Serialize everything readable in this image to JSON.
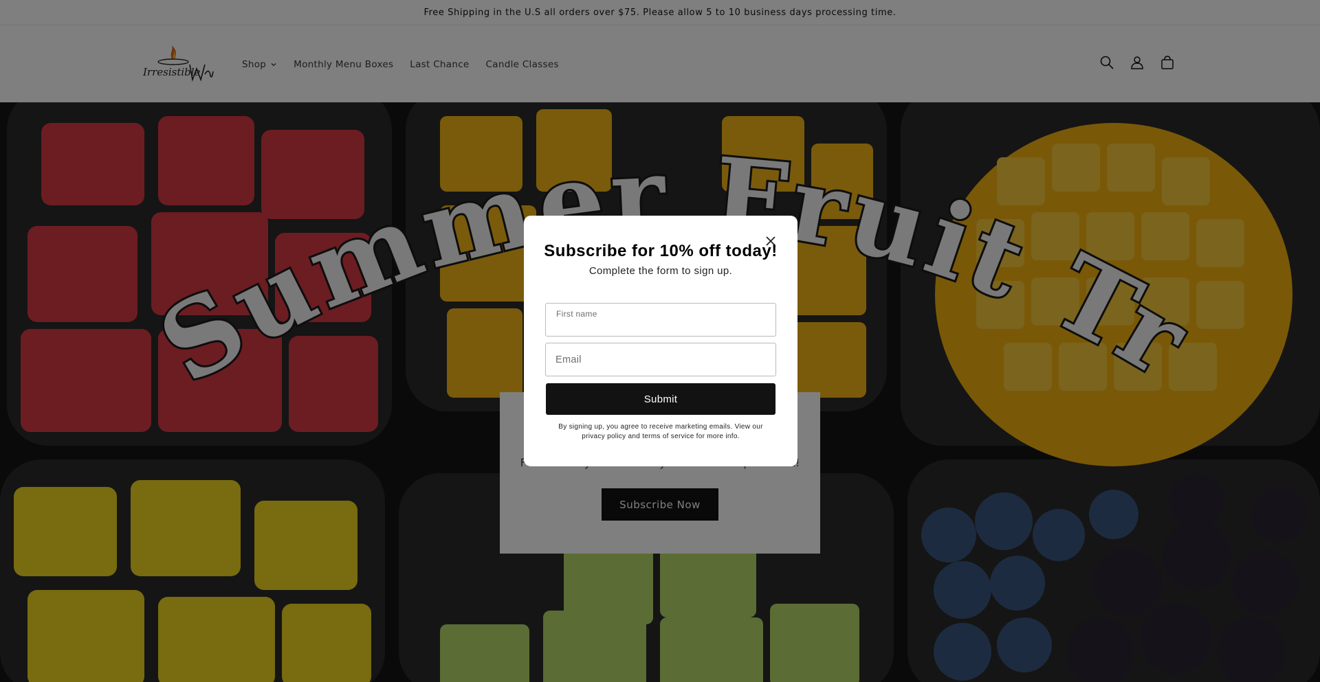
{
  "announcement": {
    "text": "Free Shipping in the U.S all orders over $75. Please allow 5 to 10 business days processing time."
  },
  "header": {
    "logo_text": "Irresistible Wax",
    "nav": [
      {
        "label": "Shop",
        "has_dropdown": true
      },
      {
        "label": "Monthly Menu Boxes"
      },
      {
        "label": "Last Chance"
      },
      {
        "label": "Candle Classes"
      }
    ],
    "icons": [
      "search-icon",
      "account-icon",
      "cart-icon"
    ]
  },
  "hero": {
    "image_title": "Summer Fruit Tray",
    "promo_text": "Featured in June's Monthly Menu Subscription Box!",
    "promo_button": "Subscribe Now"
  },
  "modal": {
    "title": "Subscribe for 10% off today!",
    "subtitle": "Complete the form to sign up.",
    "first_name_label": "First name",
    "email_placeholder": "Email",
    "submit_label": "Submit",
    "disclaimer": "By signing up, you agree to receive marketing emails. View our privacy policy and terms of service for more info."
  },
  "colors": {
    "overlay": "rgba(0,0,0,0.5)",
    "button": "#121212",
    "watermelon": "#d93a45",
    "mango": "#f4b717",
    "melon": "#b7d86a",
    "blueberry": "#3b5680"
  }
}
